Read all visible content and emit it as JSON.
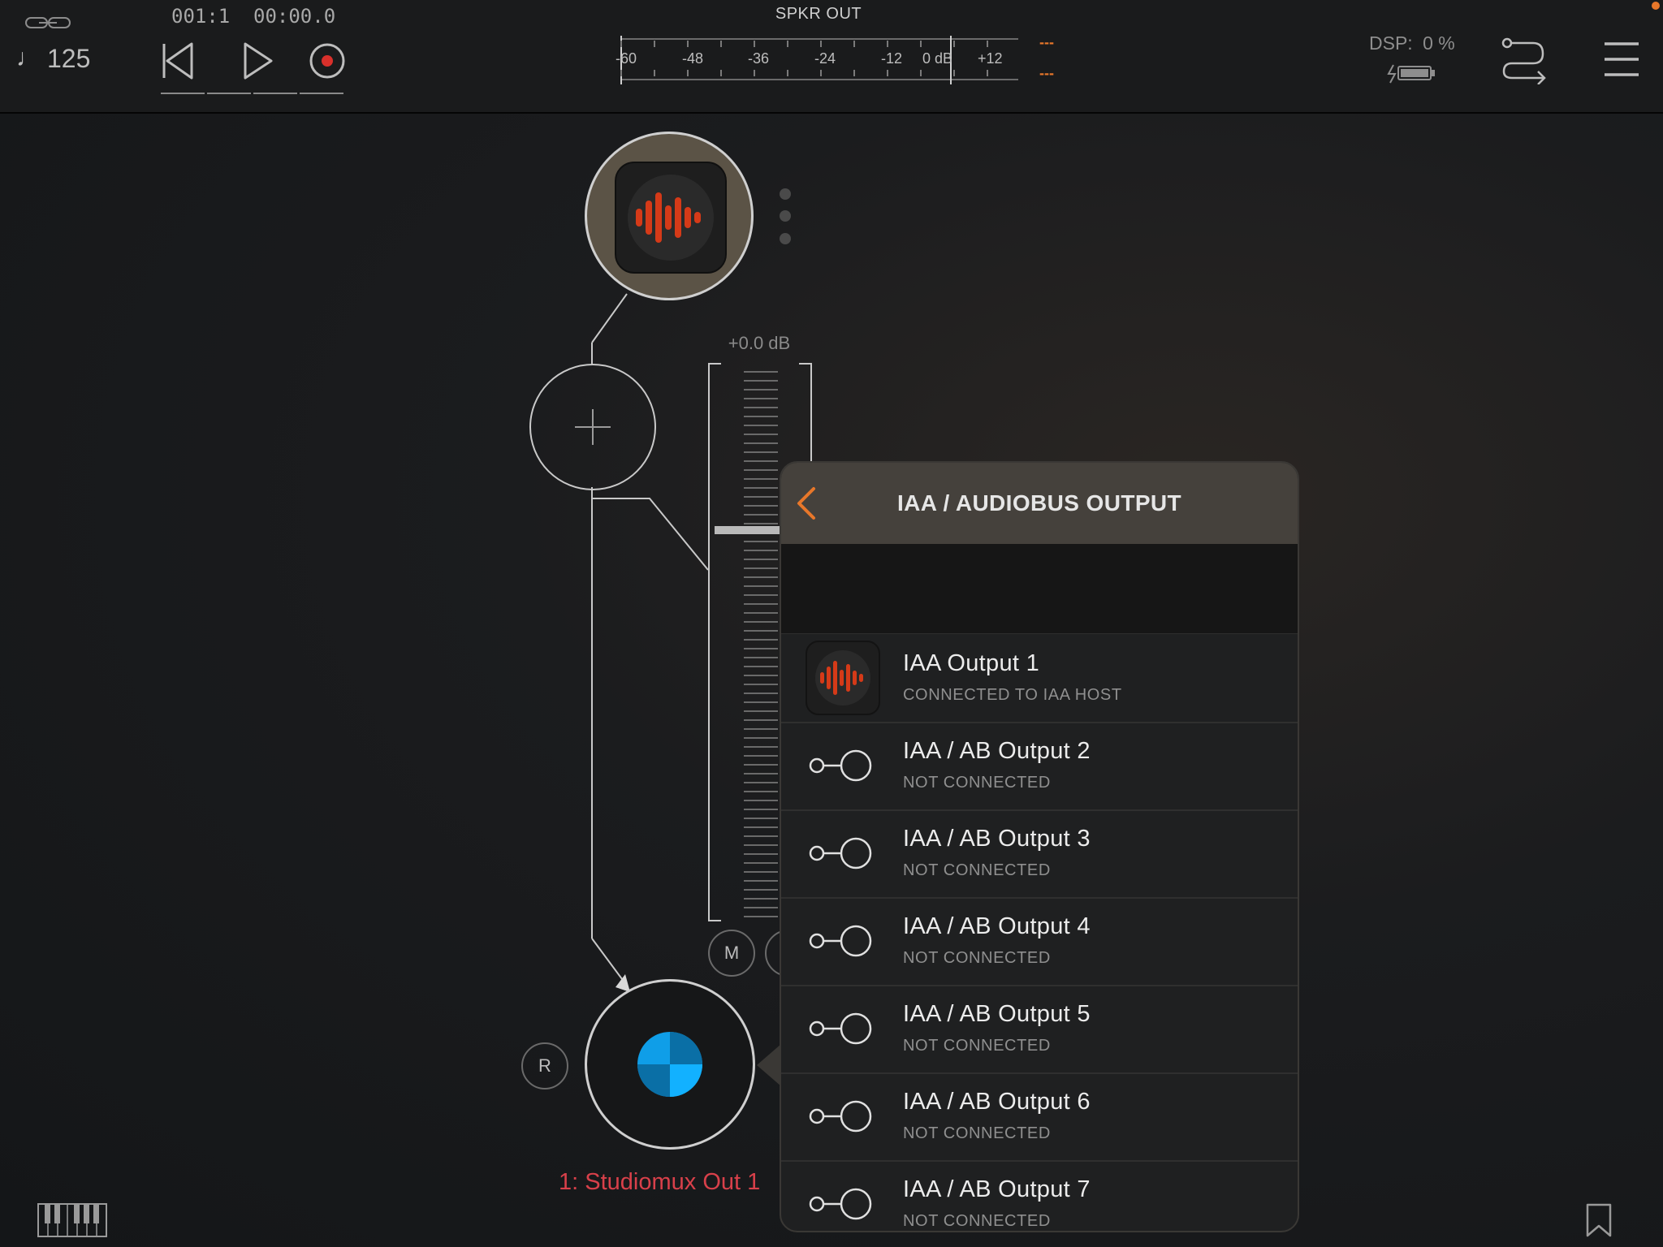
{
  "transport": {
    "tempo": "125",
    "position": "001:1",
    "time": "00:00.0"
  },
  "meter": {
    "title": "SPKR OUT",
    "ticks": [
      "-60",
      "-48",
      "-36",
      "-24",
      "-12",
      "0 dB",
      "+12"
    ],
    "peak_top": "---",
    "peak_bottom": "---"
  },
  "status": {
    "dsp_label": "DSP:",
    "dsp_value": "0 %"
  },
  "channel": {
    "gain": "+0.0 dB",
    "mute_label": "M",
    "rec_label": "R",
    "output_name": "1: Studiomux Out 1"
  },
  "panel": {
    "title": "IAA / AUDIOBUS OUTPUT",
    "items": [
      {
        "title": "IAA Output 1",
        "status": "CONNECTED TO IAA HOST"
      },
      {
        "title": "IAA / AB Output 2",
        "status": "NOT CONNECTED"
      },
      {
        "title": "IAA / AB Output 3",
        "status": "NOT CONNECTED"
      },
      {
        "title": "IAA / AB Output 4",
        "status": "NOT CONNECTED"
      },
      {
        "title": "IAA / AB Output 5",
        "status": "NOT CONNECTED"
      },
      {
        "title": "IAA / AB Output 6",
        "status": "NOT CONNECTED"
      },
      {
        "title": "IAA / AB Output 7",
        "status": "NOT CONNECTED"
      }
    ]
  },
  "colors": {
    "accent": "#e8772a",
    "record": "#d9302b",
    "app_icon": "#d53a18",
    "output_name": "#d8404a",
    "blue": "#0f9ee8"
  },
  "icons": [
    "link-icon",
    "note-icon",
    "rewind-icon",
    "play-icon",
    "record-icon",
    "battery-icon",
    "routing-icon",
    "menu-icon",
    "back-chevron-icon",
    "keyboard-icon",
    "bookmark-icon",
    "app-waveform-icon",
    "connection-icon"
  ]
}
